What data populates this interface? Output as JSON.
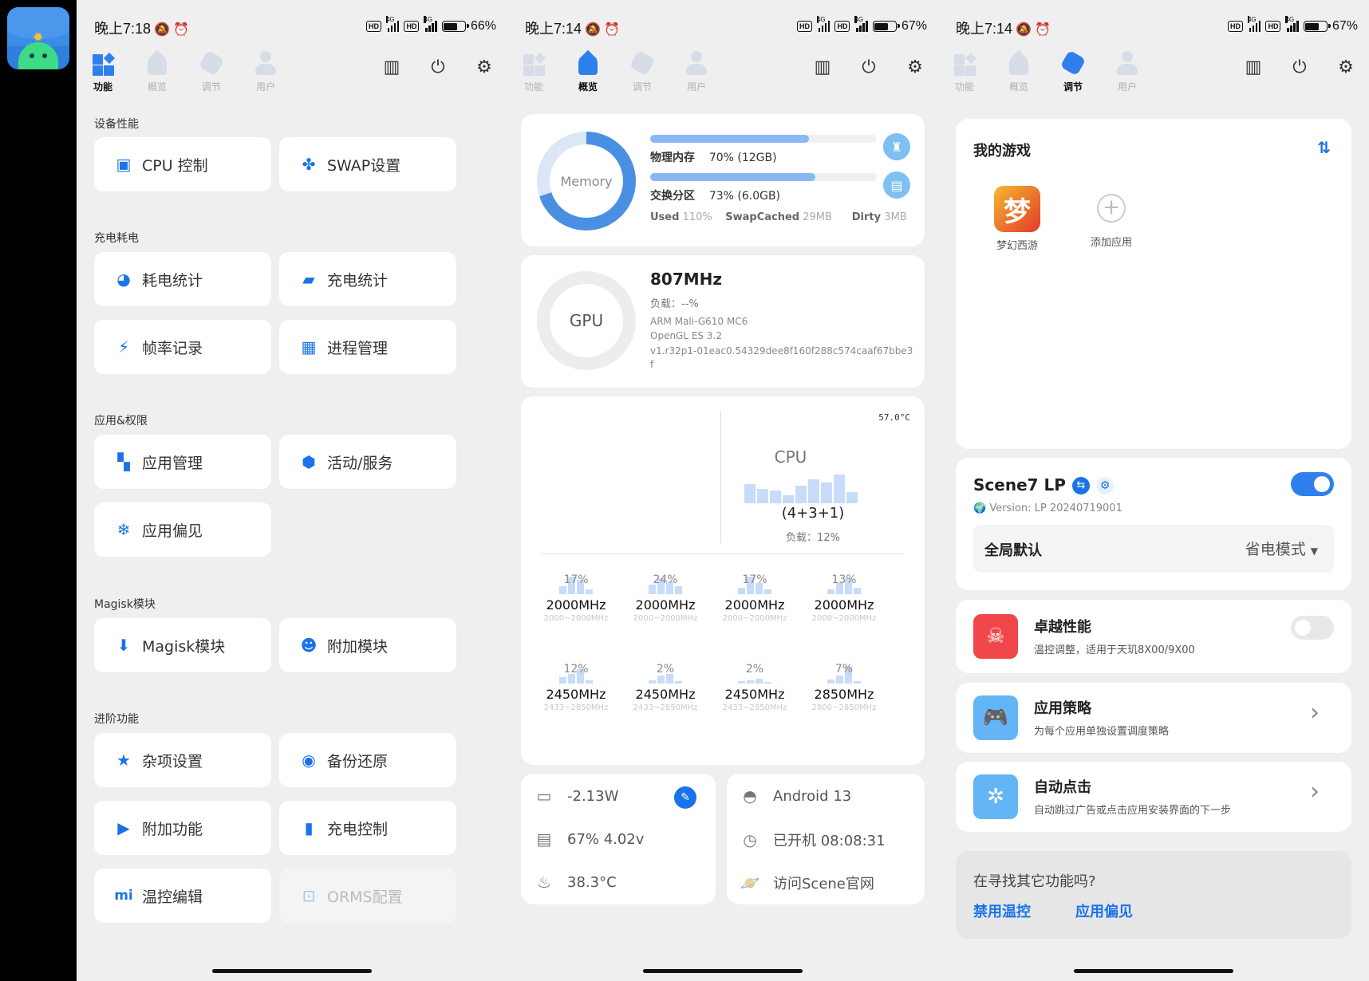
{
  "status_left": {
    "time": "晚上7:18"
  },
  "status_mid": {
    "time": "晚上7:14"
  },
  "status_right": {
    "time": "晚上7:14"
  },
  "battery": {
    "left": "66%",
    "mid": "67%",
    "right": "67%"
  },
  "tabs": [
    "功能",
    "概览",
    "调节",
    "用户"
  ],
  "features": {
    "sections": [
      {
        "title": "设备性能",
        "items": [
          {
            "label": "CPU 控制",
            "icon": "cpu-icon"
          },
          {
            "label": "SWAP设置",
            "icon": "swap-icon"
          }
        ]
      },
      {
        "title": "充电耗电",
        "items": [
          {
            "label": "耗电统计",
            "icon": "pie-icon"
          },
          {
            "label": "充电统计",
            "icon": "charge-icon"
          },
          {
            "label": "帧率记录",
            "icon": "run-icon"
          },
          {
            "label": "进程管理",
            "icon": "process-icon"
          }
        ]
      },
      {
        "title": "应用&权限",
        "items": [
          {
            "label": "应用管理",
            "icon": "apps-icon"
          },
          {
            "label": "活动/服务",
            "icon": "service-icon"
          },
          {
            "label": "应用偏见",
            "icon": "snow-icon"
          }
        ]
      },
      {
        "title": "Magisk模块",
        "items": [
          {
            "label": "Magisk模块",
            "icon": "download-icon"
          },
          {
            "label": "附加模块",
            "icon": "mask-icon"
          }
        ]
      },
      {
        "title": "进阶功能",
        "items": [
          {
            "label": "杂项设置",
            "icon": "star-icon"
          },
          {
            "label": "备份还原",
            "icon": "backup-icon"
          },
          {
            "label": "附加功能",
            "icon": "terminal-icon"
          },
          {
            "label": "充电控制",
            "icon": "battery-ctl-icon"
          },
          {
            "label": "温控编辑",
            "icon": "mi-icon"
          },
          {
            "label": "ORMS配置",
            "icon": "orms-icon",
            "disabled": true
          }
        ]
      }
    ]
  },
  "overview": {
    "memory": {
      "ring_label": "Memory",
      "physical_label": "物理内存",
      "physical_value": "70% (12GB)",
      "physical_fraction": 0.7,
      "swap_label": "交换分区",
      "swap_value": "73% (6.0GB)",
      "swap_fraction": 0.73,
      "used_label": "Used",
      "used_value": "110%",
      "swapcached_label": "SwapCached",
      "swapcached_value": "29MB",
      "dirty_label": "Dirty",
      "dirty_value": "3MB"
    },
    "gpu": {
      "ring_label": "GPU",
      "freq": "807MHz",
      "load": "负载：--%",
      "model": "ARM Mali-G610 MC6",
      "gles": "OpenGL ES 3.2",
      "driver": "v1.r32p1-01eac0.54329dee8f160f288c574caaf67bbe3f"
    },
    "cpu": {
      "temp": "57.0°C",
      "title": "CPU",
      "cluster": "(4+3+1)",
      "load": "负载：12%",
      "cores": [
        {
          "pct": "17%",
          "freq": "2000MHz",
          "range": "2000~2000MHz"
        },
        {
          "pct": "24%",
          "freq": "2000MHz",
          "range": "2000~2000MHz"
        },
        {
          "pct": "17%",
          "freq": "2000MHz",
          "range": "2000~2000MHz"
        },
        {
          "pct": "13%",
          "freq": "2000MHz",
          "range": "2000~2000MHz"
        },
        {
          "pct": "12%",
          "freq": "2450MHz",
          "range": "2433~2850MHz"
        },
        {
          "pct": "2%",
          "freq": "2450MHz",
          "range": "2433~2850MHz"
        },
        {
          "pct": "2%",
          "freq": "2450MHz",
          "range": "2433~2850MHz"
        },
        {
          "pct": "7%",
          "freq": "2850MHz",
          "range": "2800~2850MHz"
        }
      ]
    },
    "power": {
      "watts": "-2.13W",
      "battery": "67%  4.02v",
      "temp": "38.3°C"
    },
    "system": {
      "android": "Android 13",
      "uptime": "已开机  08:08:31",
      "site": "访问Scene官网"
    }
  },
  "tuning": {
    "games_title": "我的游戏",
    "games": [
      {
        "name": "梦幻西游"
      }
    ],
    "add_app": "添加应用",
    "scene_title": "Scene7 LP",
    "scene_version": "Version: LP 20240719001",
    "global_label": "全局默认",
    "global_mode": "省电模式",
    "items": [
      {
        "title": "卓越性能",
        "desc": "温控调整，适用于天玑8X00/9X00",
        "color": "#f0474a"
      },
      {
        "title": "应用策略",
        "desc": "为每个应用单独设置调度策略",
        "color": "#64b5f6"
      },
      {
        "title": "自动点击",
        "desc": "自动跳过广告或点击应用安装界面的下一步",
        "color": "#64b5f6"
      }
    ],
    "footer_q": "在寻找其它功能吗?",
    "footer_links": [
      "禁用温控",
      "应用偏见"
    ]
  }
}
